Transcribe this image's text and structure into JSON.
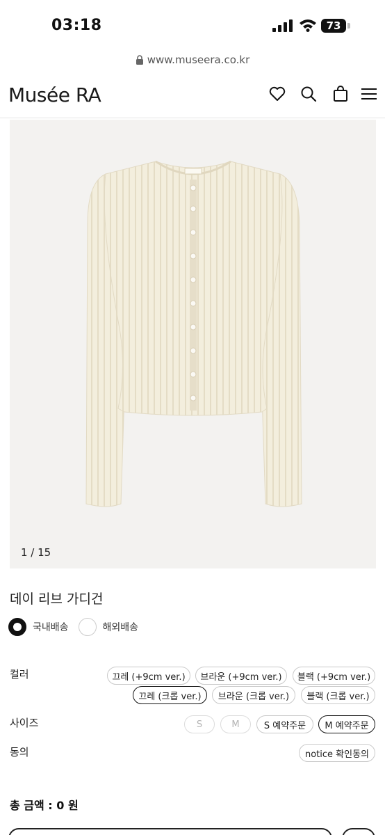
{
  "status_bar": {
    "time": "03:18",
    "battery": "73"
  },
  "browser": {
    "url": "www.museera.co.kr"
  },
  "header": {
    "logo": "Musée RA",
    "icons": [
      "heart-icon",
      "search-icon",
      "bag-icon",
      "menu-icon"
    ]
  },
  "product": {
    "image_counter": "1 / 15",
    "title": "데이 리브 가디건"
  },
  "shipping": {
    "options": [
      {
        "label": "국내배송",
        "selected": true
      },
      {
        "label": "해외배송",
        "selected": false
      }
    ]
  },
  "options": {
    "color_label": "컬러",
    "colors_row1": [
      "끄레 (+9cm ver.)",
      "브라운 (+9cm ver.)",
      "블랙 (+9cm ver.)"
    ],
    "colors_row2": [
      "끄레 (크롭 ver.)",
      "브라운 (크롭 ver.)",
      "블랙 (크롭 ver.)"
    ],
    "selected_color": "끄레 (크롭 ver.)",
    "size_label": "사이즈",
    "sizes": [
      "S",
      "M",
      "S 예약주문",
      "M 예약주문"
    ],
    "disabled_sizes": [
      "S",
      "M"
    ],
    "selected_size": "M 예약주문",
    "consent_label": "동의",
    "consent_option": "notice 확인동의"
  },
  "total": {
    "text": "총 금액 : 0 원"
  },
  "colors": {
    "text": "#111111",
    "border": "#c9c9c9",
    "image_bg": "#f3f2f0",
    "cardigan": "#f3eedd"
  }
}
